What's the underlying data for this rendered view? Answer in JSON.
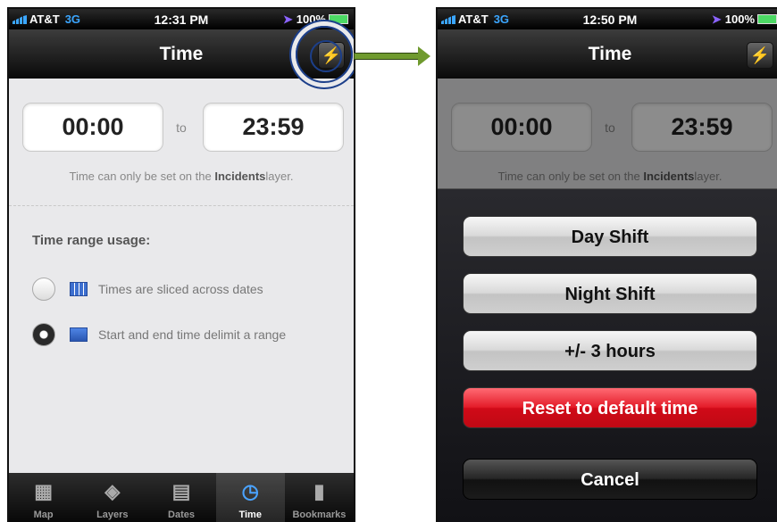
{
  "status_left": {
    "carrier": "AT&T",
    "network": "3G",
    "time": "12:31 PM",
    "battery": "100%"
  },
  "status_right": {
    "carrier": "AT&T",
    "network": "3G",
    "time": "12:50 PM",
    "battery": "100%"
  },
  "nav": {
    "title": "Time"
  },
  "time_range": {
    "start": "00:00",
    "to_label": "to",
    "end": "23:59"
  },
  "note": {
    "prefix": "Time can only be set on the ",
    "layer": "Incidents",
    "suffix": "layer."
  },
  "usage": {
    "title": "Time range usage:",
    "options": [
      {
        "label": "Times are sliced across dates",
        "selected": false
      },
      {
        "label": "Start and end time delimit a range",
        "selected": true
      }
    ]
  },
  "tabs": [
    {
      "label": "Map",
      "icon": "map-icon"
    },
    {
      "label": "Layers",
      "icon": "layers-icon"
    },
    {
      "label": "Dates",
      "icon": "calendar-icon"
    },
    {
      "label": "Time",
      "icon": "clock-icon",
      "active": true
    },
    {
      "label": "Bookmarks",
      "icon": "bookmark-icon"
    }
  ],
  "action_sheet": {
    "day_shift": "Day Shift",
    "night_shift": "Night Shift",
    "plus_minus": "+/- 3 hours",
    "reset": "Reset to default time",
    "cancel": "Cancel"
  },
  "colors": {
    "accent_blue": "#4aa3ff",
    "reset_red": "#e41d2a",
    "arrow_green": "#6f9a2e",
    "highlight_ring": "#1c3f8a"
  }
}
